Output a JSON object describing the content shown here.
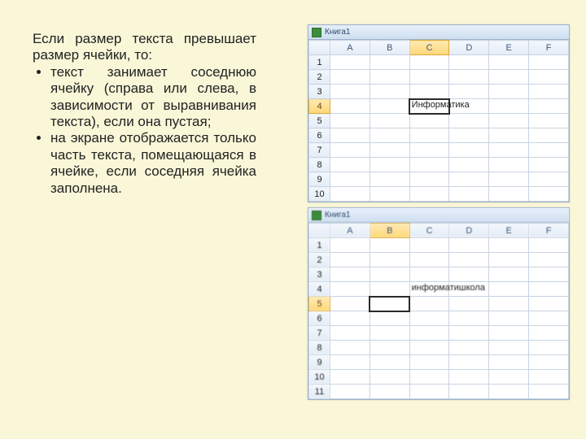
{
  "text": {
    "intro": "Если размер текста превышает размер ячейки, то:",
    "bullets": [
      "текст занимает соседнюю ячейку (справа или слева, в зависимости от выравнивания текста), если она пустая;",
      "на экране отображается только часть текста, помещающаяся в ячейке, если соседняя ячейка заполнена."
    ]
  },
  "sheet1": {
    "title": "Книга1",
    "columns": [
      "A",
      "B",
      "C",
      "D",
      "E",
      "F"
    ],
    "rows": [
      "1",
      "2",
      "3",
      "4",
      "5",
      "6",
      "7",
      "8",
      "9",
      "10"
    ],
    "selectedCol": "C",
    "selectedRow": "4",
    "cellText": "Информатика",
    "cellAt": {
      "row": "4",
      "col": "C"
    }
  },
  "sheet2": {
    "title": "Книга1",
    "columns": [
      "A",
      "B",
      "C",
      "D",
      "E",
      "F"
    ],
    "rows": [
      "1",
      "2",
      "3",
      "4",
      "5",
      "6",
      "7",
      "8",
      "9",
      "10",
      "11"
    ],
    "selectedCol": "B",
    "selectedRow": "5",
    "cellText": "информатишкола",
    "cellAt": {
      "row": "4",
      "col": "C"
    }
  }
}
